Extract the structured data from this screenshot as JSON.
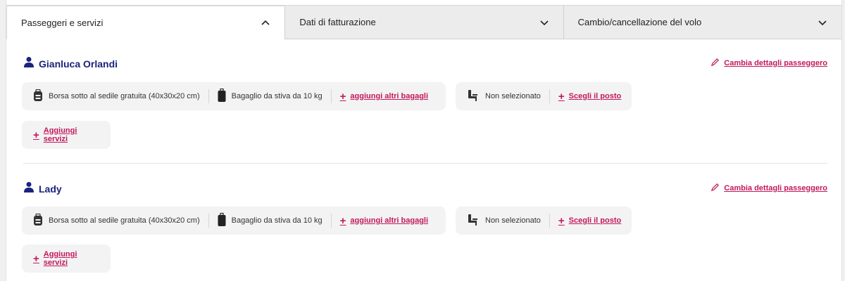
{
  "tabs": [
    {
      "label": "Passeggeri e servizi",
      "state": "expanded"
    },
    {
      "label": "Dati di fatturazione",
      "state": "collapsed"
    },
    {
      "label": "Cambio/cancellazione del volo",
      "state": "collapsed"
    }
  ],
  "passengers": [
    {
      "name": "Gianluca Orlandi",
      "edit_label": "Cambia dettagli passeggero",
      "bag_free": "Borsa sotto al sedile gratuita (40x30x20 cm)",
      "bag_hold": "Bagaglio da stiva da 10 kg",
      "add_bags": "aggiungi altri bagagli",
      "seat_status": "Non selezionato",
      "choose_seat": "Scegli il posto",
      "add_services": "Aggiungi servizi"
    },
    {
      "name": "Lady",
      "edit_label": "Cambia dettagli passeggero",
      "bag_free": "Borsa sotto al sedile gratuita (40x30x20 cm)",
      "bag_hold": "Bagaglio da stiva da 10 kg",
      "add_bags": "aggiungi altri bagagli",
      "seat_status": "Non selezionato",
      "choose_seat": "Scegli il posto",
      "add_services": "Aggiungi servizi"
    }
  ],
  "colors": {
    "accent": "#c2185b",
    "name": "#1a237e",
    "chip_bg": "#f3f3f3"
  }
}
